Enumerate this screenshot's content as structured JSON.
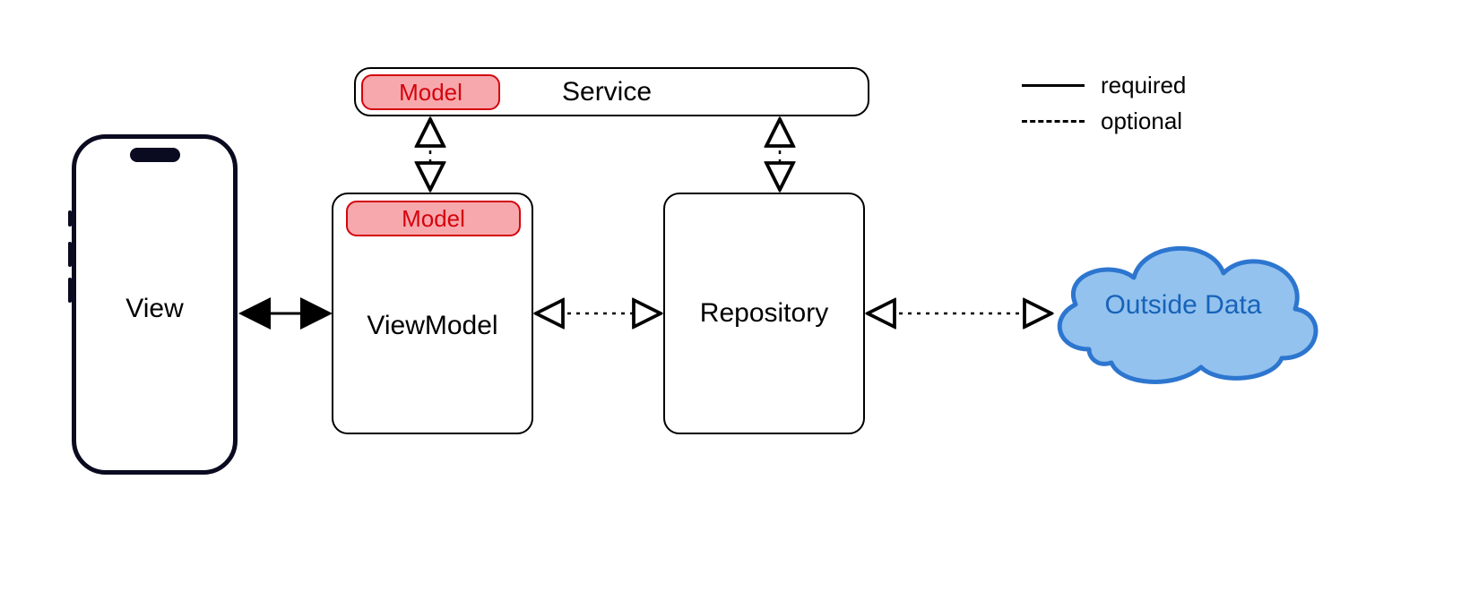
{
  "nodes": {
    "view": {
      "label": "View"
    },
    "service": {
      "model_label": "Model",
      "label": "Service"
    },
    "viewmodel": {
      "model_label": "Model",
      "label": "ViewModel"
    },
    "repository": {
      "label": "Repository"
    },
    "outside_data": {
      "label": "Outside Data"
    }
  },
  "legend": {
    "required": "required",
    "optional": "optional"
  },
  "colors": {
    "model_border": "#d4040d",
    "model_fill": "#f7a8ad",
    "cloud_border": "#2d76cf",
    "cloud_fill": "#93c2ef"
  }
}
